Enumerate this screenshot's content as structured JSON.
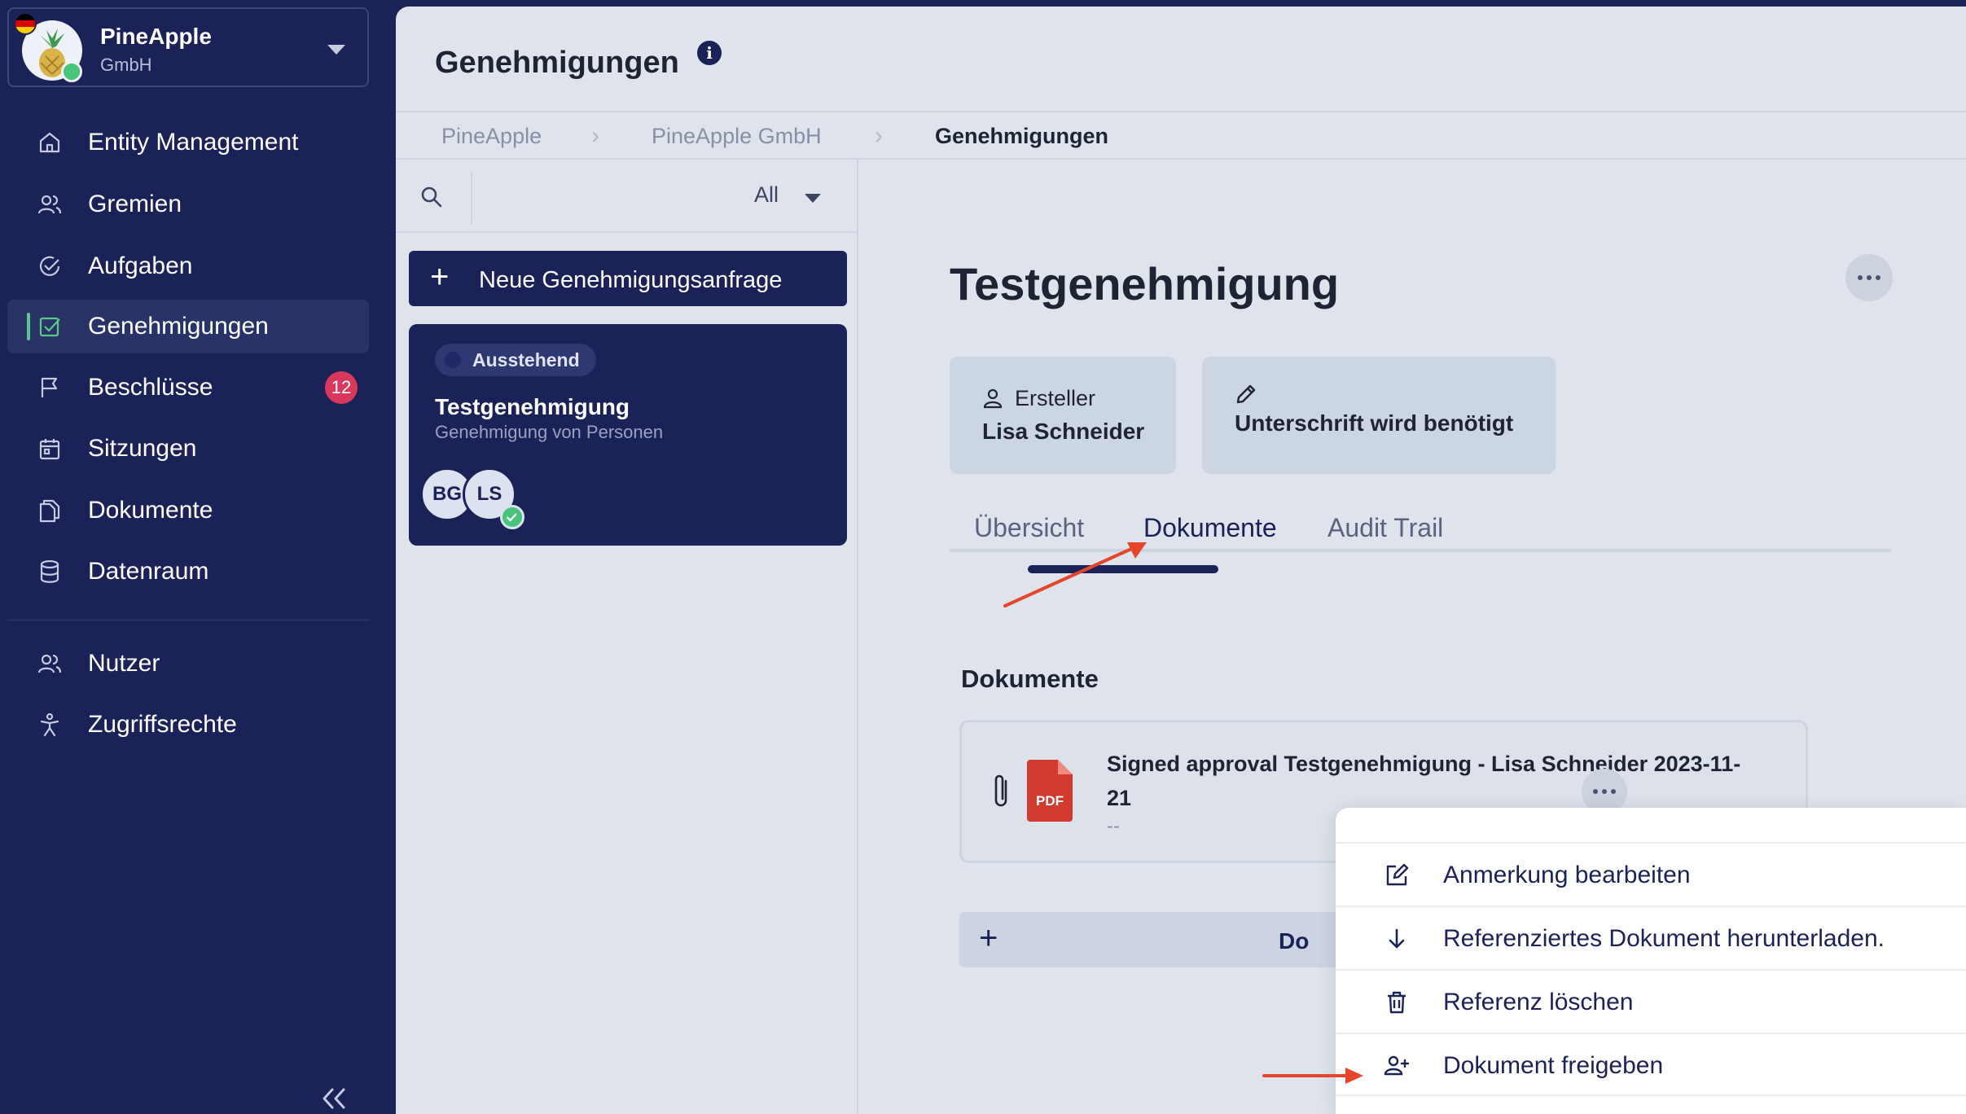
{
  "sidebar": {
    "org": {
      "name": "PineApple",
      "subtitle": "GmbH"
    },
    "nav": [
      {
        "label": "Entity Management",
        "icon": "home-icon"
      },
      {
        "label": "Gremien",
        "icon": "users-icon"
      },
      {
        "label": "Aufgaben",
        "icon": "check-circle-icon"
      },
      {
        "label": "Genehmigungen",
        "icon": "check-square-icon",
        "active": true
      },
      {
        "label": "Beschlüsse",
        "icon": "flag-icon",
        "badge": "12"
      },
      {
        "label": "Sitzungen",
        "icon": "calendar-icon"
      },
      {
        "label": "Dokumente",
        "icon": "documents-icon"
      },
      {
        "label": "Datenraum",
        "icon": "database-icon"
      }
    ],
    "nav_secondary": [
      {
        "label": "Nutzer",
        "icon": "users-icon"
      },
      {
        "label": "Zugriffsrechte",
        "icon": "accessibility-icon"
      }
    ],
    "collapse_glyph": "«"
  },
  "header": {
    "title": "Genehmigungen",
    "info_glyph": "i"
  },
  "breadcrumb": [
    "PineApple",
    "PineApple GmbH",
    "Genehmigungen"
  ],
  "breadcrumb_separator": "›",
  "list": {
    "filter_value": "All",
    "new_button_label": "Neue Genehmigungsanfrage",
    "new_button_glyph": "+",
    "cards": [
      {
        "status": "Ausstehend",
        "title": "Testgenehmigung",
        "subtitle": "Genehmigung von Personen",
        "avatars": [
          "BG",
          "LS"
        ]
      }
    ]
  },
  "detail": {
    "title": "Testgenehmigung",
    "creator_label": "Ersteller",
    "creator_name": "Lisa Schneider",
    "signature_status": "Unterschrift wird benötigt",
    "tabs": [
      "Übersicht",
      "Dokumente",
      "Audit Trail"
    ],
    "active_tab": "Dokumente",
    "section_title": "Dokumente",
    "document": {
      "name": "Signed approval Testgenehmigung - Lisa Schneider 2023-11-21",
      "meta": "--",
      "type_label": "PDF"
    },
    "add_button_glyph": "+",
    "add_button_label_partial": "Do"
  },
  "context_menu": {
    "items": [
      {
        "label": "Anmerkung bearbeiten",
        "icon": "edit-icon"
      },
      {
        "label": "Referenziertes Dokument herunterladen.",
        "icon": "arrow-down-icon"
      },
      {
        "label": "Referenz löschen",
        "icon": "trash-icon"
      },
      {
        "label": "Dokument freigeben",
        "icon": "user-plus-icon"
      }
    ]
  },
  "colors": {
    "sidebar_bg": "#1a2257",
    "accent_green": "#58c98a",
    "badge_red": "#d9375c",
    "annotation_arrow": "#e5462b",
    "pdf_red": "#d03a2f"
  }
}
